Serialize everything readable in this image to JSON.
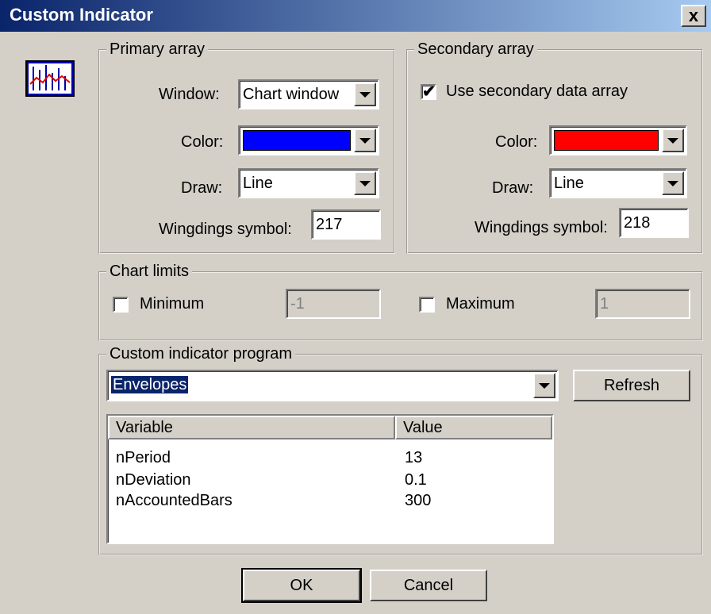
{
  "window": {
    "title": "Custom Indicator",
    "close_glyph": "x"
  },
  "primary": {
    "legend": "Primary array",
    "window_label": "Window:",
    "window_value": "Chart window",
    "color_label": "Color:",
    "color_value": "#0000ff",
    "draw_label": "Draw:",
    "draw_value": "Line",
    "wingdings_label": "Wingdings symbol:",
    "wingdings_value": "217"
  },
  "secondary": {
    "legend": "Secondary array",
    "use_secondary_label": "Use secondary data array",
    "use_secondary_checked": true,
    "color_label": "Color:",
    "color_value": "#ff0000",
    "draw_label": "Draw:",
    "draw_value": "Line",
    "wingdings_label": "Wingdings symbol:",
    "wingdings_value": "218"
  },
  "chart_limits": {
    "legend": "Chart limits",
    "minimum_label": "Minimum",
    "minimum_checked": false,
    "minimum_value": "-1",
    "maximum_label": "Maximum",
    "maximum_checked": false,
    "maximum_value": "1"
  },
  "program": {
    "legend": "Custom indicator program",
    "selected": "Envelopes",
    "refresh_label": "Refresh",
    "columns": [
      "Variable",
      "Value"
    ],
    "rows": [
      {
        "variable": "nPeriod",
        "value": "13"
      },
      {
        "variable": "nDeviation",
        "value": "0.1"
      },
      {
        "variable": "nAccountedBars",
        "value": "300"
      }
    ]
  },
  "buttons": {
    "ok": "OK",
    "cancel": "Cancel"
  },
  "icons": {
    "indicator": "chart-indicator-icon",
    "checkmark": "✔"
  }
}
